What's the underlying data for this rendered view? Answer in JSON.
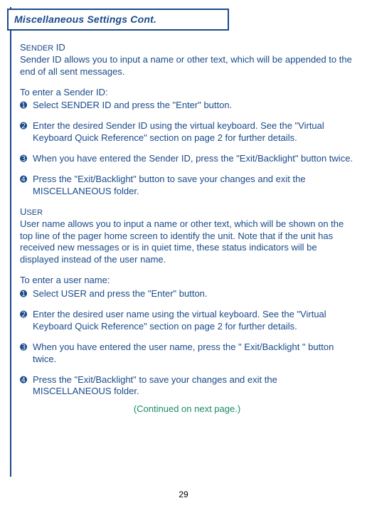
{
  "title": "Miscellaneous Settings Cont.",
  "pageNumber": "29",
  "continued": "(Continued on next page.)",
  "sections": [
    {
      "heading_main": "S",
      "heading_rest": "ENDER",
      "heading_suffix": " ID",
      "intro": "Sender ID allows you to input a name or other text, which will be appended to the end of all sent messages.",
      "lead": "To enter a Sender ID:",
      "steps": [
        "Select SENDER ID and press the \"Enter\" button.",
        "Enter the desired Sender ID using the virtual keyboard.  See the \"Virtual Keyboard Quick Reference\" section on page 2 for further details.",
        "When you have entered the Sender ID, press the \"Exit/Backlight\" button twice.",
        "Press the \"Exit/Backlight\" button to save your changes and exit the MISCELLANEOUS folder."
      ]
    },
    {
      "heading_main": "U",
      "heading_rest": "SER",
      "heading_suffix": "",
      "intro": "User name allows you to input a name or other text, which will be shown on the top line of the pager home screen to identify the unit.  Note that if the unit has received new messages or is in quiet time, these status indicators will be displayed instead of the user name.",
      "lead": "To enter a user name:",
      "steps": [
        "Select USER and press the \"Enter\" button.",
        "Enter the desired user name using the virtual keyboard.  See the \"Virtual Keyboard Quick Reference\" section on page 2 for further details.",
        "When you have entered the user name, press the \" Exit/Backlight \" button twice.",
        "Press the \"Exit/Backlight\" to save your changes and exit the MISCELLANEOUS folder."
      ]
    }
  ],
  "bullets": [
    "➊",
    "➋",
    "➌",
    "➍"
  ]
}
